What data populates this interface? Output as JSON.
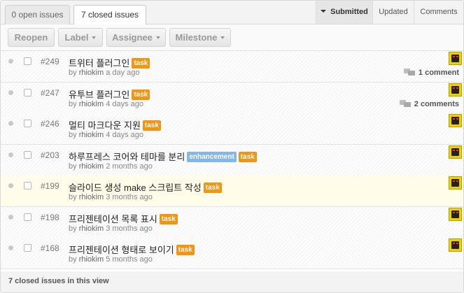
{
  "tabs": {
    "open": "0 open issues",
    "closed": "7 closed issues"
  },
  "sort": {
    "submitted": "Submitted",
    "updated": "Updated",
    "comments": "Comments"
  },
  "toolbar": {
    "reopen": "Reopen",
    "label": "Label",
    "assignee": "Assignee",
    "milestone": "Milestone"
  },
  "issues": [
    {
      "number": "#249",
      "title": "트위터 플러그인",
      "labels": [
        {
          "text": "task",
          "color": "#f29513"
        }
      ],
      "author": "rhiokim",
      "time": "a day ago",
      "comments": "1 comment",
      "highlight": false
    },
    {
      "number": "#247",
      "title": "유투브 플러그인",
      "labels": [
        {
          "text": "task",
          "color": "#f29513"
        }
      ],
      "author": "rhiokim",
      "time": "4 days ago",
      "comments": "2 comments",
      "highlight": false
    },
    {
      "number": "#246",
      "title": "멀티 마크다운 지원",
      "labels": [
        {
          "text": "task",
          "color": "#f29513"
        }
      ],
      "author": "rhiokim",
      "time": "4 days ago",
      "comments": "",
      "highlight": false
    },
    {
      "number": "#203",
      "title": "하루프레스 코어와 테마를 분리",
      "labels": [
        {
          "text": "enhancement",
          "color": "#84b6eb"
        },
        {
          "text": "task",
          "color": "#f29513"
        }
      ],
      "author": "rhiokim",
      "time": "2 months ago",
      "comments": "",
      "highlight": false
    },
    {
      "number": "#199",
      "title": "슬라이드 생성 make 스크립트 작성",
      "labels": [
        {
          "text": "task",
          "color": "#f29513"
        }
      ],
      "author": "rhiokim",
      "time": "3 months ago",
      "comments": "",
      "highlight": true
    },
    {
      "number": "#198",
      "title": "프리젠테이션 목록 표시",
      "labels": [
        {
          "text": "task",
          "color": "#f29513"
        }
      ],
      "author": "rhiokim",
      "time": "3 months ago",
      "comments": "",
      "highlight": false
    },
    {
      "number": "#168",
      "title": "프리젠테이션 형태로 보이기",
      "labels": [
        {
          "text": "task",
          "color": "#f29513"
        }
      ],
      "author": "rhiokim",
      "time": "5 months ago",
      "comments": "",
      "highlight": false
    }
  ],
  "by_prefix": "by",
  "footer": "7 closed issues in this view",
  "icons": {
    "sort_caret": "caret-down-icon",
    "comment": "comment-bubbles-icon",
    "avatar": "user-avatar"
  }
}
